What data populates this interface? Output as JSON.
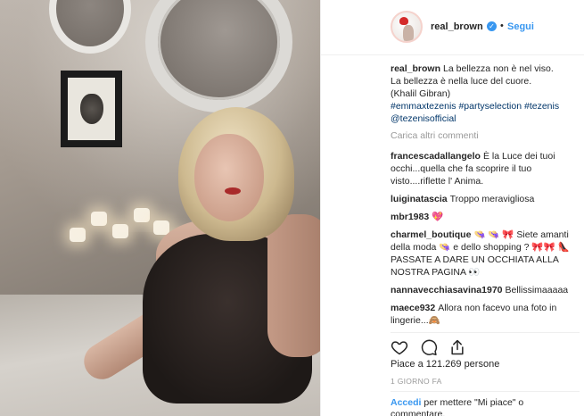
{
  "post": {
    "username": "real_brown",
    "verified_icon": "verified-badge-icon",
    "separator": "•",
    "follow_label": "Segui"
  },
  "caption": {
    "user": "real_brown",
    "line1": "La bellezza non è nel viso.",
    "line2": "La bellezza è nella luce del cuore.",
    "line3": "(Khalil Gibran)",
    "tags1": "#emmaxtezenis #partyselection #tezenis",
    "tags2": "@tezenisofficial"
  },
  "load_more_label": "Carica altri commenti",
  "comments": [
    {
      "user": "francescadallangelo",
      "text": "È la Luce dei tuoi occhi...quella che fa scoprire il tuo visto....riflette l' Anima."
    },
    {
      "user": "luiginatascia",
      "text": "Troppo meravigliosa"
    },
    {
      "user": "mbr1983",
      "text": "💖"
    },
    {
      "user": "charmel_boutique",
      "text": "👒 👒 🎀 Siete amanti della moda 👒 e dello shopping ? 🎀🎀 👠 PASSATE A DARE UN OCCHIATA ALLA NOSTRA PAGINA 👀"
    },
    {
      "user": "nannavecchiasavina1970",
      "text": "Bellissimaaaaa"
    },
    {
      "user": "maece932",
      "text": "Allora non facevo una foto in lingerie...🙈"
    }
  ],
  "actions": {
    "like_icon": "heart-icon",
    "comment_icon": "comment-icon",
    "share_icon": "share-icon"
  },
  "likes_text": "Piace a 121.269 persone",
  "time_text": "1 GIORNO FA",
  "login": {
    "link_label": "Accedi",
    "rest_text": "per mettere \"Mi piace\" o commentare."
  },
  "colors": {
    "link": "#3897f0",
    "text": "#262626",
    "muted": "#999999",
    "verified": "#3897f0"
  }
}
